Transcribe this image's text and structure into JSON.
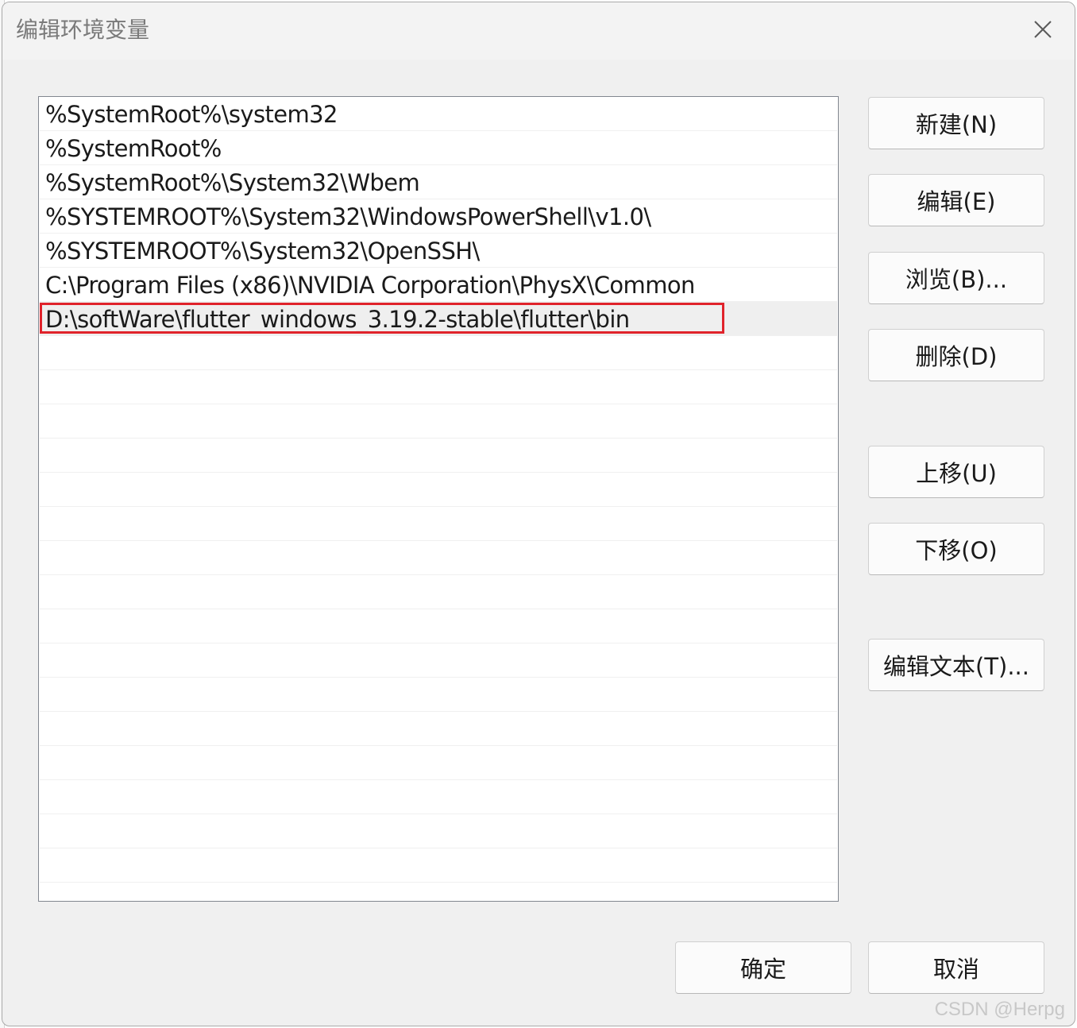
{
  "dialog": {
    "title": "编辑环境变量",
    "close_icon": "close-icon"
  },
  "path_list": {
    "items": [
      "%SystemRoot%\\system32",
      "%SystemRoot%",
      "%SystemRoot%\\System32\\Wbem",
      "%SYSTEMROOT%\\System32\\WindowsPowerShell\\v1.0\\",
      "%SYSTEMROOT%\\System32\\OpenSSH\\",
      "C:\\Program Files (x86)\\NVIDIA Corporation\\PhysX\\Common",
      "D:\\softWare\\flutter_windows_3.19.2-stable\\flutter\\bin"
    ],
    "selected_index": 6,
    "highlight_color": "#e0232b"
  },
  "buttons": {
    "new": "新建(N)",
    "edit": "编辑(E)",
    "browse": "浏览(B)...",
    "delete": "删除(D)",
    "move_up": "上移(U)",
    "move_down": "下移(O)",
    "edit_text": "编辑文本(T)...",
    "ok": "确定",
    "cancel": "取消"
  },
  "watermark": "CSDN @Herpg"
}
